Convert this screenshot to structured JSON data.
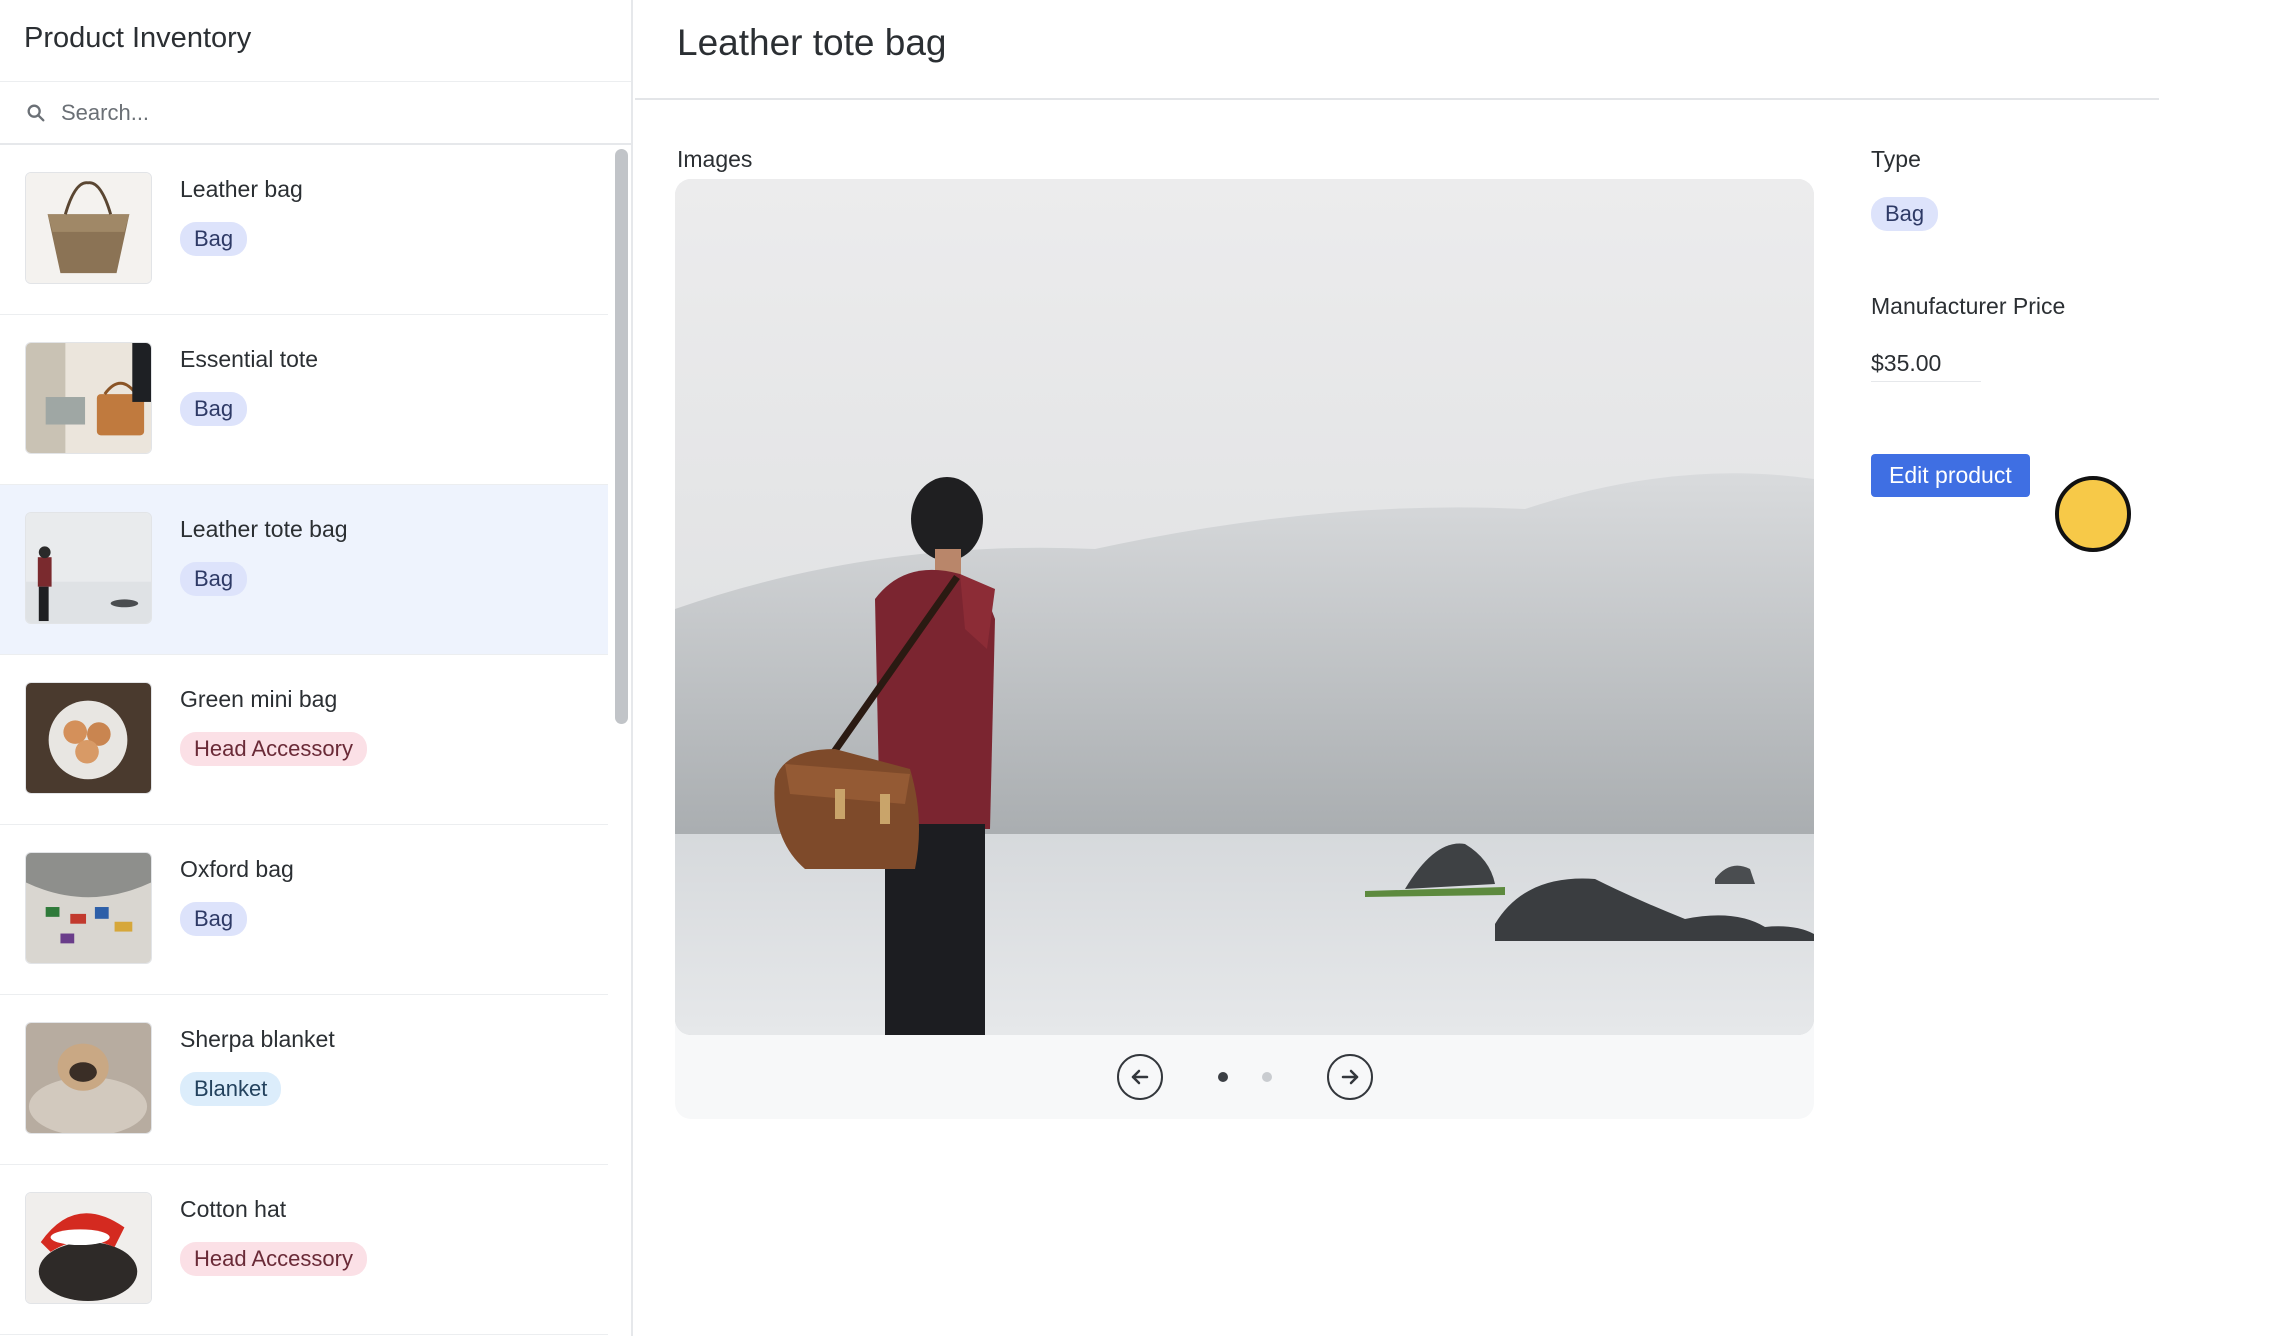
{
  "sidebar": {
    "title": "Product Inventory",
    "search_placeholder": "Search...",
    "items": [
      {
        "name": "Leather bag",
        "tag": "Bag"
      },
      {
        "name": "Essential tote",
        "tag": "Bag"
      },
      {
        "name": "Leather tote bag",
        "tag": "Bag"
      },
      {
        "name": "Green mini bag",
        "tag": "Head Accessory"
      },
      {
        "name": "Oxford bag",
        "tag": "Bag"
      },
      {
        "name": "Sherpa blanket",
        "tag": "Blanket"
      },
      {
        "name": "Cotton hat",
        "tag": "Head Accessory"
      }
    ]
  },
  "main": {
    "title": "Leather tote bag",
    "images_label": "Images",
    "carousel": {
      "current_page": 1,
      "total_pages": 2
    },
    "type_label": "Type",
    "type_value": "Bag",
    "price_label": "Manufacturer Price",
    "price_value": "$35.00",
    "edit_button": "Edit product"
  },
  "colors": {
    "accent": "#3f6fe3",
    "selected_row": "#eef3fd",
    "tag_bag": "#dde3fb",
    "tag_head_accessory": "#fbe0e6",
    "tag_blanket": "#dcedfb",
    "cursor": "#f7c948"
  }
}
